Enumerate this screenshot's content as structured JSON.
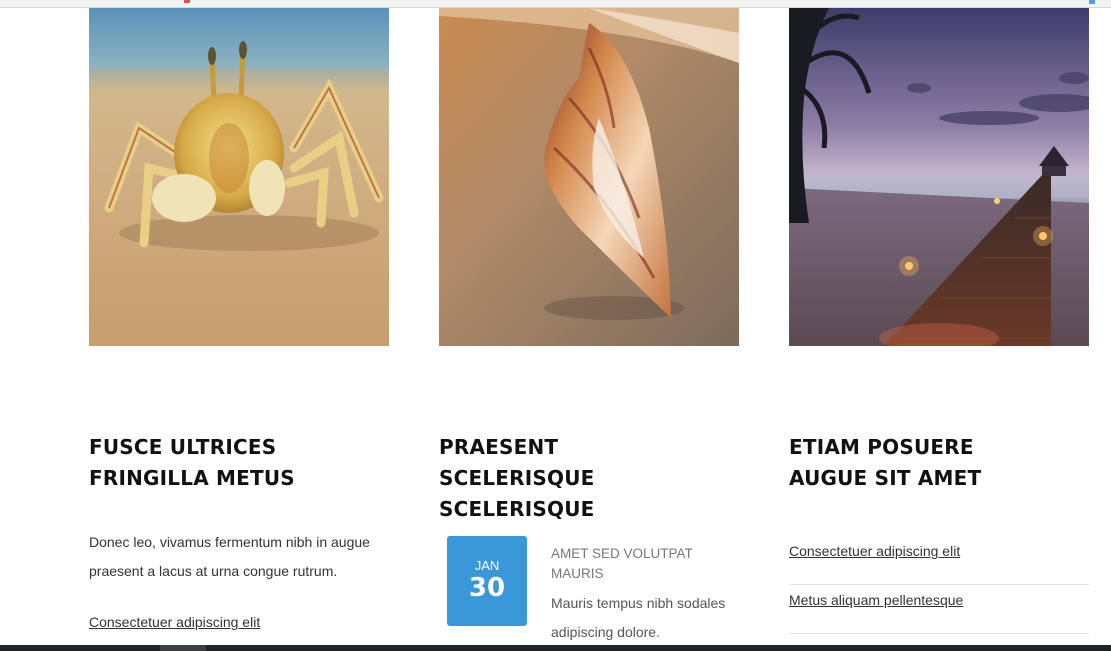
{
  "columns": [
    {
      "image_alt": "crab-on-beach",
      "title_line1": "FUSCE ULTRICES",
      "title_line2": "FRINGILLA METUS",
      "description": "Donec leo, vivamus fermentum nibh in augue praesent a lacus at urna congue rutrum.",
      "link": "Consectetuer adipiscing elit"
    },
    {
      "image_alt": "seashell-on-sand",
      "title_line1": "PRAESENT",
      "title_line2": "SCELERISQUE SCELERISQUE",
      "event": {
        "month": "JAN",
        "day": "30",
        "title": "AMET SED VOLUTPAT MAURIS",
        "description": "Mauris tempus nibh sodales adipiscing dolore."
      }
    },
    {
      "image_alt": "pier-at-sunset",
      "title_line1": "ETIAM POSUERE",
      "title_line2": "AUGUE SIT AMET",
      "links": [
        "Consectetuer adipiscing elit",
        "Metus aliquam pellentesque"
      ]
    }
  ],
  "colors": {
    "date_badge": "#3a98d8",
    "heading": "#111111",
    "body_text": "#333333"
  }
}
